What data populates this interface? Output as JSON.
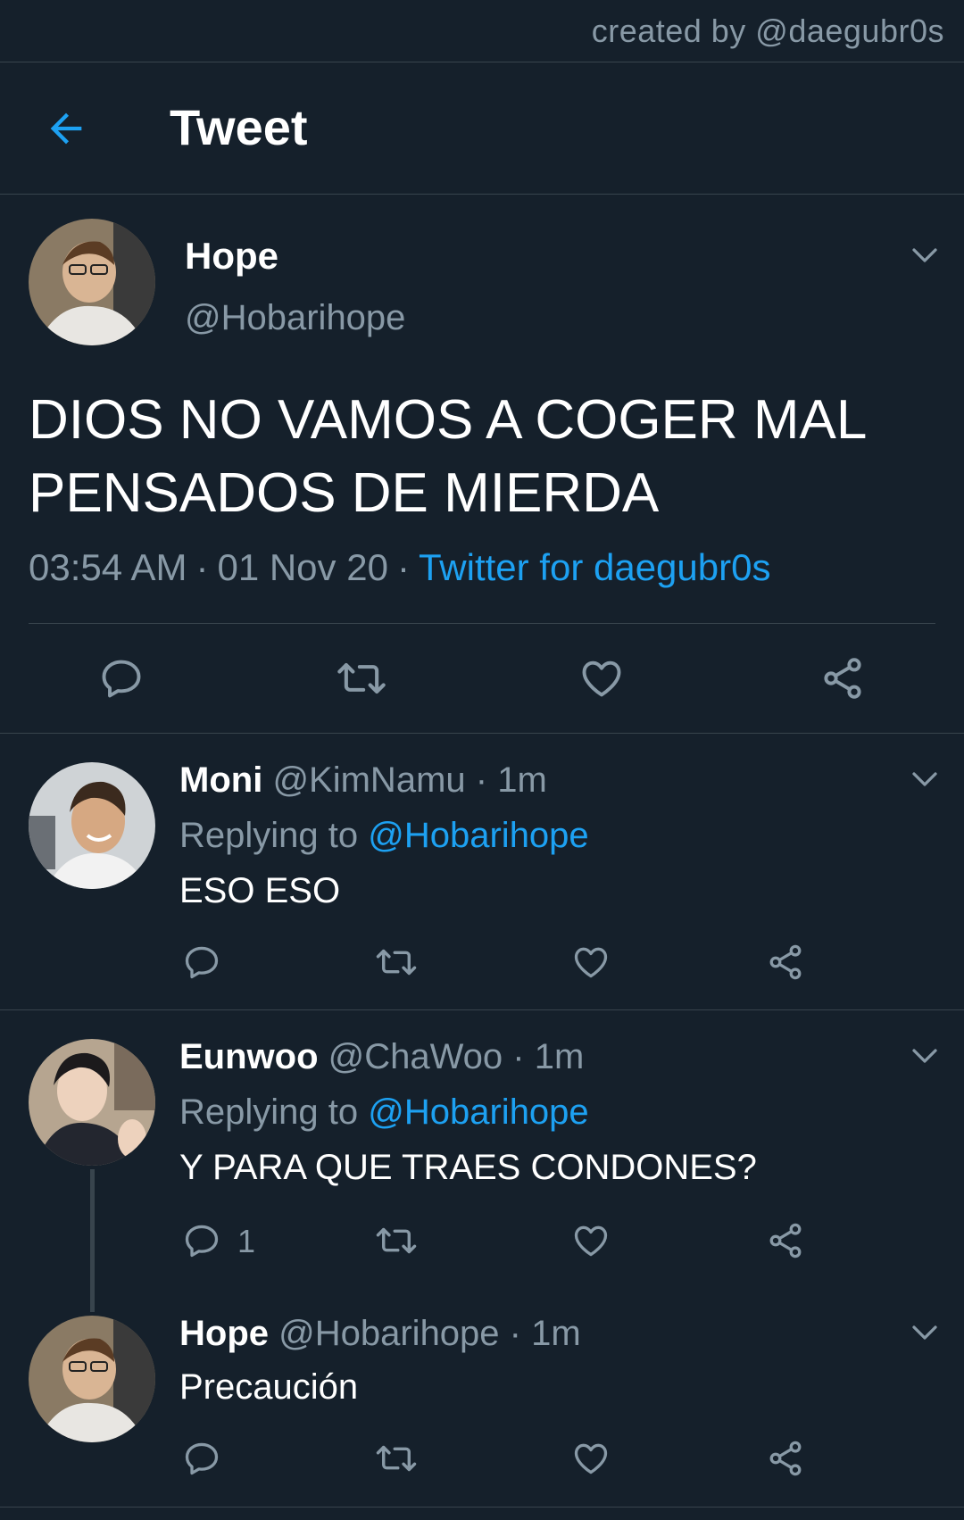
{
  "watermark": "created by @daegubr0s",
  "header": {
    "title": "Tweet"
  },
  "main_tweet": {
    "name": "Hope",
    "handle": "@Hobarihope",
    "text": "DIOS NO VAMOS A COGER MAL PENSADOS DE MIERDA",
    "time": "03:54 AM",
    "date": "01 Nov 20",
    "source": "Twitter for daegubr0s"
  },
  "replies": [
    {
      "name": "Moni",
      "handle": "@KimNamu",
      "sep": "·",
      "time": "1m",
      "replying_prefix": "Replying to",
      "replying_handle": "@Hobarihope",
      "text": "ESO ESO",
      "reply_count": ""
    },
    {
      "name": "Eunwoo",
      "handle": "@ChaWoo",
      "sep": "·",
      "time": "1m",
      "replying_prefix": "Replying to",
      "replying_handle": "@Hobarihope",
      "text": "Y PARA QUE TRAES CONDONES?",
      "reply_count": "1"
    },
    {
      "name": "Hope",
      "handle": "@Hobarihope",
      "sep": "·",
      "time": "1m",
      "text": "Precaución",
      "reply_count": ""
    }
  ],
  "colors": {
    "background": "#15202b",
    "accent": "#1da1f2",
    "muted": "#8899a6",
    "divider": "#38444d"
  },
  "icons": [
    "back-arrow-icon",
    "chevron-down-icon",
    "reply-icon",
    "retweet-icon",
    "like-icon",
    "share-icon"
  ]
}
